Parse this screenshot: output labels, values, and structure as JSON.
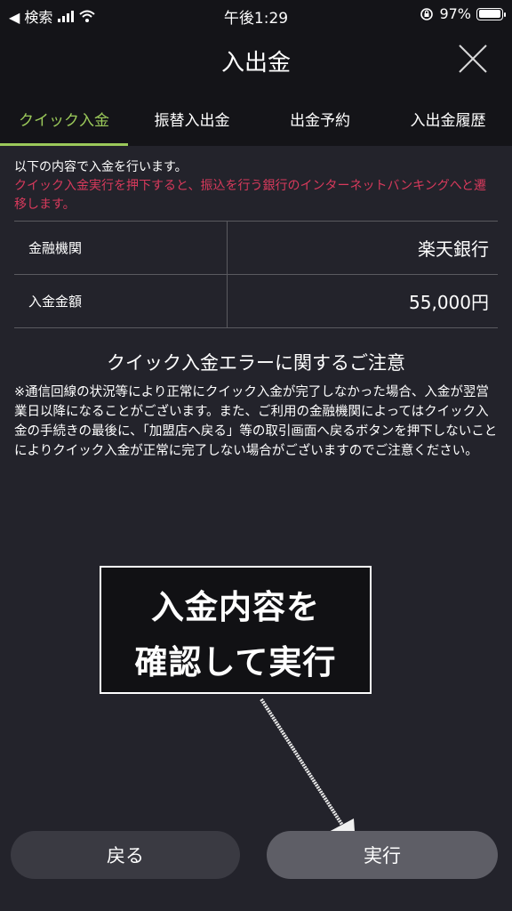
{
  "status_bar": {
    "back_label": "◀ 検索",
    "time": "午後1:29",
    "battery": "97%",
    "battery_level": 0.97
  },
  "header": {
    "title": "入出金"
  },
  "tabs": [
    {
      "label": "クイック入金"
    },
    {
      "label": "振替入出金"
    },
    {
      "label": "出金予約"
    },
    {
      "label": "入出金履歴"
    }
  ],
  "notice": {
    "line1": "以下の内容で入金を行います。",
    "red": "クイック入金実行を押下すると、振込を行う銀行のインターネットバンキングへと遷移します。"
  },
  "table": {
    "rows": [
      {
        "label": "金融機関",
        "value": "楽天銀行"
      },
      {
        "label": "入金金額",
        "value": "55,000円"
      }
    ]
  },
  "caution": {
    "title": "クイック入金エラーに関するご注意",
    "body": "※通信回線の状況等により正常にクイック入金が完了しなかった場合、入金が翌営業日以降になることがございます。また、ご利用の金融機関によってはクイック入金の手続きの最後に、「加盟店へ戻る」等の取引画面へ戻るボタンを押下しないことによりクイック入金が正常に完了しない場合がございますのでご注意ください。"
  },
  "callout": {
    "line1": "入金内容を",
    "line2": "確認して実行"
  },
  "buttons": {
    "back": "戻る",
    "execute": "実行"
  },
  "colors": {
    "accent": "#9bc95a",
    "warning": "#d83a5c"
  }
}
